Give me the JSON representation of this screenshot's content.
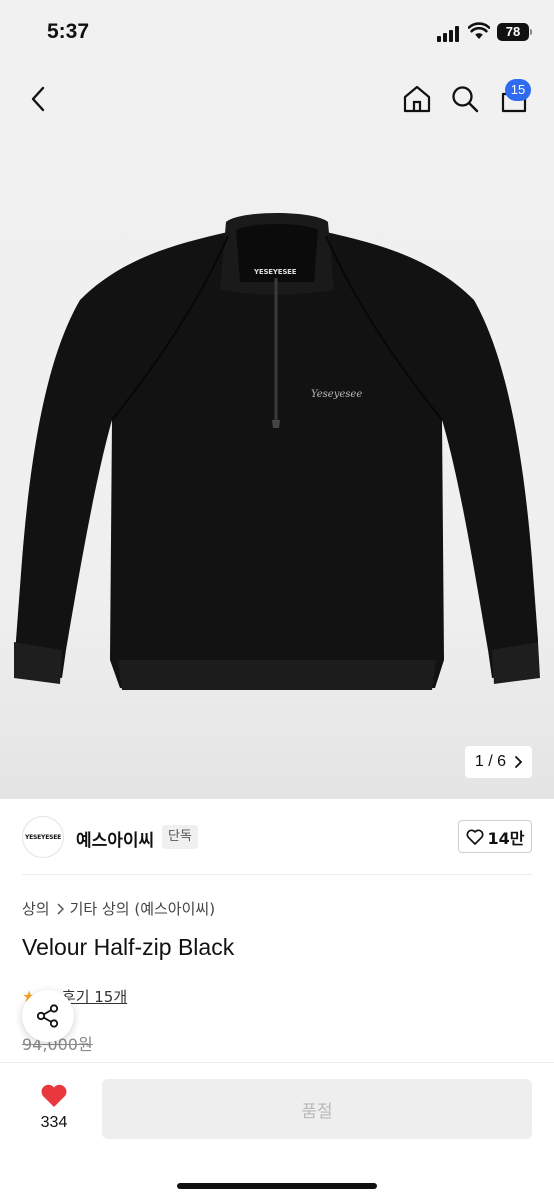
{
  "status_bar": {
    "time": "5:37",
    "battery": "78"
  },
  "header": {
    "back_icon": "chevron-left-icon",
    "home_icon": "home-icon",
    "search_icon": "search-icon",
    "cart_icon": "shopping-bag-icon",
    "cart_count": "15"
  },
  "gallery": {
    "counter": "1 / 6",
    "next_icon": "chevron-right-icon",
    "collar_label": "YESEYESEE",
    "chest_logo": "Yeseyesee"
  },
  "brand": {
    "logo_text": "YESEYESEE",
    "name": "예스아이씨",
    "tag": "단독",
    "like_icon": "heart-outline-icon",
    "like_count": "14만"
  },
  "product": {
    "breadcrumb": [
      "상의",
      "기타 상의 (예스아이씨)"
    ],
    "title": "Velour Half-zip Black",
    "rating": "3",
    "review_link": "후기 15개",
    "original_price": "94,000원"
  },
  "share": {
    "icon": "share-icon"
  },
  "bottom_bar": {
    "wish_icon": "heart-filled-icon",
    "wish_count": "334",
    "action_label": "품절"
  },
  "colors": {
    "accent_blue": "#2f6bf0",
    "heart_red": "#e8383d",
    "disabled_bg": "#eeeeee",
    "disabled_text": "#b9b9b9"
  }
}
